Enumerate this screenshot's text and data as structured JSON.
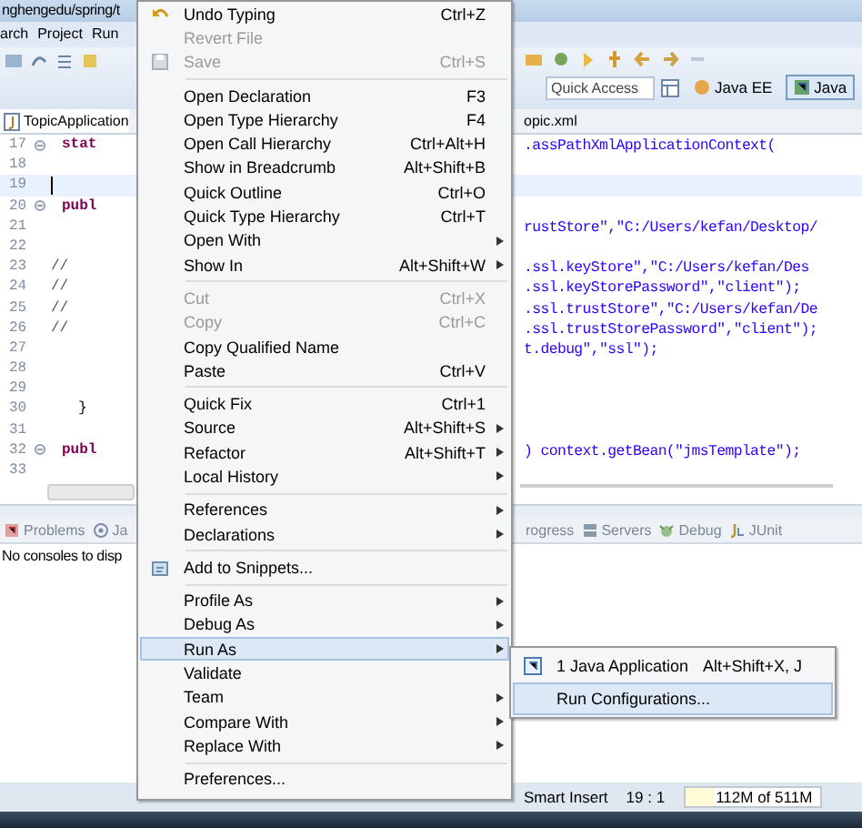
{
  "window": {
    "title": "nghengedu/spring/t"
  },
  "menu_bar": [
    "arch",
    "Project",
    "Run"
  ],
  "toolbar": {
    "quick_access": {
      "placeholder": "Quick Access"
    },
    "perspectives": [
      {
        "label": "Java EE",
        "selected": false
      },
      {
        "label": "Java",
        "selected": true
      }
    ]
  },
  "editor": {
    "tabs": [
      {
        "label": "TopicApplication",
        "selected": true
      },
      {
        "label": "opic.xml",
        "selected": false
      }
    ],
    "lines": [
      {
        "number": "17",
        "kind": "keyword",
        "fold": true,
        "current": false,
        "left": "stat",
        "right": ".assPathXmlApplicationContext("
      },
      {
        "number": "18",
        "fold": false,
        "current": false
      },
      {
        "number": "19",
        "fold": false,
        "current": true
      },
      {
        "number": "20",
        "kind": "keyword",
        "fold": true,
        "current": false,
        "left": "publ"
      },
      {
        "number": "21",
        "fold": false,
        "current": false,
        "right": "rustStore\",\"C:/Users/kefan/Desktop/"
      },
      {
        "number": "22",
        "fold": false,
        "current": false
      },
      {
        "number": "23",
        "kind": "comment",
        "fold": false,
        "current": false,
        "left": "//",
        "right": ".ssl.keyStore\",\"C:/Users/kefan/Des"
      },
      {
        "number": "24",
        "kind": "comment",
        "fold": false,
        "current": false,
        "left": "//",
        "right": ".ssl.keyStorePassword\",\"client\");"
      },
      {
        "number": "25",
        "kind": "comment",
        "fold": false,
        "current": false,
        "left": "//",
        "right": ".ssl.trustStore\",\"C:/Users/kefan/De"
      },
      {
        "number": "26",
        "kind": "comment",
        "fold": false,
        "current": false,
        "left": "//",
        "right": ".ssl.trustStorePassword\",\"client\");"
      },
      {
        "number": "27",
        "fold": false,
        "current": false,
        "right": "t.debug\",\"ssl\");"
      },
      {
        "number": "28",
        "fold": false,
        "current": false
      },
      {
        "number": "29",
        "fold": false,
        "current": false
      },
      {
        "number": "30",
        "kind": "plain",
        "fold": false,
        "current": false,
        "left": "}"
      },
      {
        "number": "31",
        "fold": false,
        "current": false
      },
      {
        "number": "32",
        "kind": "keyword",
        "fold": true,
        "current": false,
        "left": "publ",
        "right": ") context.getBean(\"jmsTemplate\");"
      },
      {
        "number": "33",
        "fold": false,
        "current": false
      }
    ]
  },
  "bottom_panel": {
    "left_tabs": [
      {
        "label": "Problems"
      },
      {
        "label": "Ja"
      }
    ],
    "right_tabs": [
      {
        "label": "rogress"
      },
      {
        "label": "Servers"
      },
      {
        "label": "Debug"
      },
      {
        "label": "JUnit"
      }
    ],
    "message": "No consoles to disp"
  },
  "context_menu": {
    "items": [
      {
        "kind": "item",
        "label": "Undo Typing",
        "shortcut": "Ctrl+Z",
        "disabled": false,
        "submenu": false,
        "selected": false
      },
      {
        "kind": "item",
        "label": "Revert File",
        "disabled": true,
        "submenu": false,
        "selected": false
      },
      {
        "kind": "item",
        "label": "Save",
        "shortcut": "Ctrl+S",
        "disabled": true,
        "submenu": false,
        "selected": false
      },
      {
        "kind": "separator"
      },
      {
        "kind": "item",
        "label": "Open Declaration",
        "shortcut": "F3",
        "disabled": false,
        "submenu": false,
        "selected": false
      },
      {
        "kind": "item",
        "label": "Open Type Hierarchy",
        "shortcut": "F4",
        "disabled": false,
        "submenu": false,
        "selected": false
      },
      {
        "kind": "item",
        "label": "Open Call Hierarchy",
        "shortcut": "Ctrl+Alt+H",
        "disabled": false,
        "submenu": false,
        "selected": false
      },
      {
        "kind": "item",
        "label": "Show in Breadcrumb",
        "shortcut": "Alt+Shift+B",
        "disabled": false,
        "submenu": false,
        "selected": false
      },
      {
        "kind": "item",
        "label": "Quick Outline",
        "shortcut": "Ctrl+O",
        "disabled": false,
        "submenu": false,
        "selected": false
      },
      {
        "kind": "item",
        "label": "Quick Type Hierarchy",
        "shortcut": "Ctrl+T",
        "disabled": false,
        "submenu": false,
        "selected": false
      },
      {
        "kind": "item",
        "label": "Open With",
        "disabled": false,
        "submenu": true,
        "selected": false
      },
      {
        "kind": "item",
        "label": "Show In",
        "shortcut": "Alt+Shift+W",
        "disabled": false,
        "submenu": true,
        "selected": false
      },
      {
        "kind": "separator"
      },
      {
        "kind": "item",
        "label": "Cut",
        "shortcut": "Ctrl+X",
        "disabled": true,
        "submenu": false,
        "selected": false
      },
      {
        "kind": "item",
        "label": "Copy",
        "shortcut": "Ctrl+C",
        "disabled": true,
        "submenu": false,
        "selected": false
      },
      {
        "kind": "item",
        "label": "Copy Qualified Name",
        "disabled": false,
        "submenu": false,
        "selected": false
      },
      {
        "kind": "item",
        "label": "Paste",
        "shortcut": "Ctrl+V",
        "disabled": false,
        "submenu": false,
        "selected": false
      },
      {
        "kind": "separator"
      },
      {
        "kind": "item",
        "label": "Quick Fix",
        "shortcut": "Ctrl+1",
        "disabled": false,
        "submenu": false,
        "selected": false
      },
      {
        "kind": "item",
        "label": "Source",
        "shortcut": "Alt+Shift+S",
        "disabled": false,
        "submenu": true,
        "selected": false
      },
      {
        "kind": "item",
        "label": "Refactor",
        "shortcut": "Alt+Shift+T",
        "disabled": false,
        "submenu": true,
        "selected": false
      },
      {
        "kind": "item",
        "label": "Local History",
        "disabled": false,
        "submenu": true,
        "selected": false
      },
      {
        "kind": "separator"
      },
      {
        "kind": "item",
        "label": "References",
        "disabled": false,
        "submenu": true,
        "selected": false
      },
      {
        "kind": "item",
        "label": "Declarations",
        "disabled": false,
        "submenu": true,
        "selected": false
      },
      {
        "kind": "separator"
      },
      {
        "kind": "item",
        "label": "Add to Snippets...",
        "disabled": false,
        "submenu": false,
        "selected": false
      },
      {
        "kind": "separator"
      },
      {
        "kind": "item",
        "label": "Profile As",
        "disabled": false,
        "submenu": true,
        "selected": false
      },
      {
        "kind": "item",
        "label": "Debug As",
        "disabled": false,
        "submenu": true,
        "selected": false
      },
      {
        "kind": "item",
        "label": "Run As",
        "disabled": false,
        "submenu": true,
        "selected": true
      },
      {
        "kind": "item",
        "label": "Validate",
        "disabled": false,
        "submenu": false,
        "selected": false
      },
      {
        "kind": "item",
        "label": "Team",
        "disabled": false,
        "submenu": true,
        "selected": false
      },
      {
        "kind": "item",
        "label": "Compare With",
        "disabled": false,
        "submenu": true,
        "selected": false
      },
      {
        "kind": "item",
        "label": "Replace With",
        "disabled": false,
        "submenu": true,
        "selected": false
      },
      {
        "kind": "separator"
      },
      {
        "kind": "item",
        "label": "Preferences...",
        "disabled": false,
        "submenu": false,
        "selected": false
      }
    ]
  },
  "submenu": {
    "items": [
      {
        "label": "1 Java Application",
        "shortcut": "Alt+Shift+X, J",
        "selected": false
      },
      {
        "label": "Run Configurations...",
        "selected": true
      }
    ]
  },
  "status_bar": {
    "mode": "Smart Insert",
    "position": "19 : 1",
    "heap": "112M of 511M"
  }
}
